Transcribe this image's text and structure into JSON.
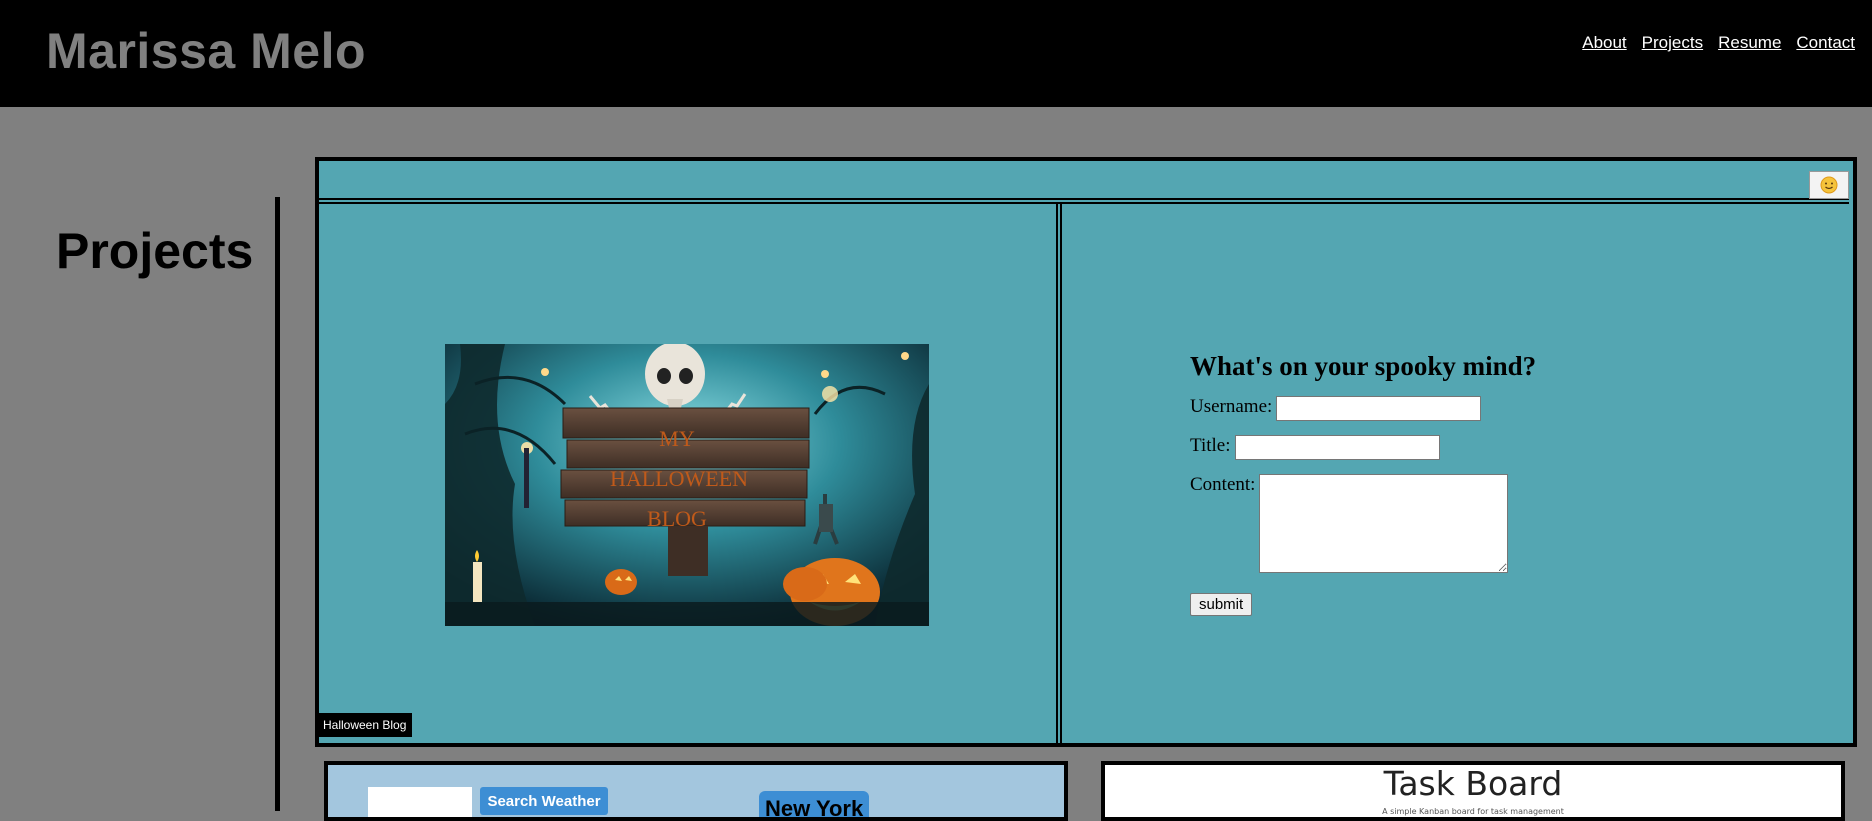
{
  "header": {
    "site_title": "Marissa Melo",
    "nav": [
      {
        "label": "About"
      },
      {
        "label": "Projects"
      },
      {
        "label": "Resume"
      },
      {
        "label": "Contact"
      }
    ]
  },
  "sidebar": {
    "heading": "Projects"
  },
  "halloween_project": {
    "caption": "Halloween Blog",
    "image_sign_text": [
      "MY",
      "HALLOWEEN",
      "BLOG"
    ],
    "theme_toggle_icon": "sun-emoji-icon",
    "form": {
      "heading": "What's on your spooky mind?",
      "username_label": "Username:",
      "title_label": "Title:",
      "content_label": "Content:",
      "username_value": "",
      "title_value": "",
      "content_value": "",
      "submit_label": "submit"
    }
  },
  "weather_project": {
    "search_input_value": "",
    "search_button": "Search Weather",
    "city": "New York"
  },
  "task_project": {
    "title": "Task Board",
    "subtitle": "A simple Kanban board for task management"
  },
  "colors": {
    "page_bg": "#808080",
    "header_bg": "#000000",
    "card_teal": "#54a6b2",
    "weather_bg": "#a3c6de",
    "accent_blue": "#3d8ed4",
    "sign_text": "#c05a1a"
  }
}
